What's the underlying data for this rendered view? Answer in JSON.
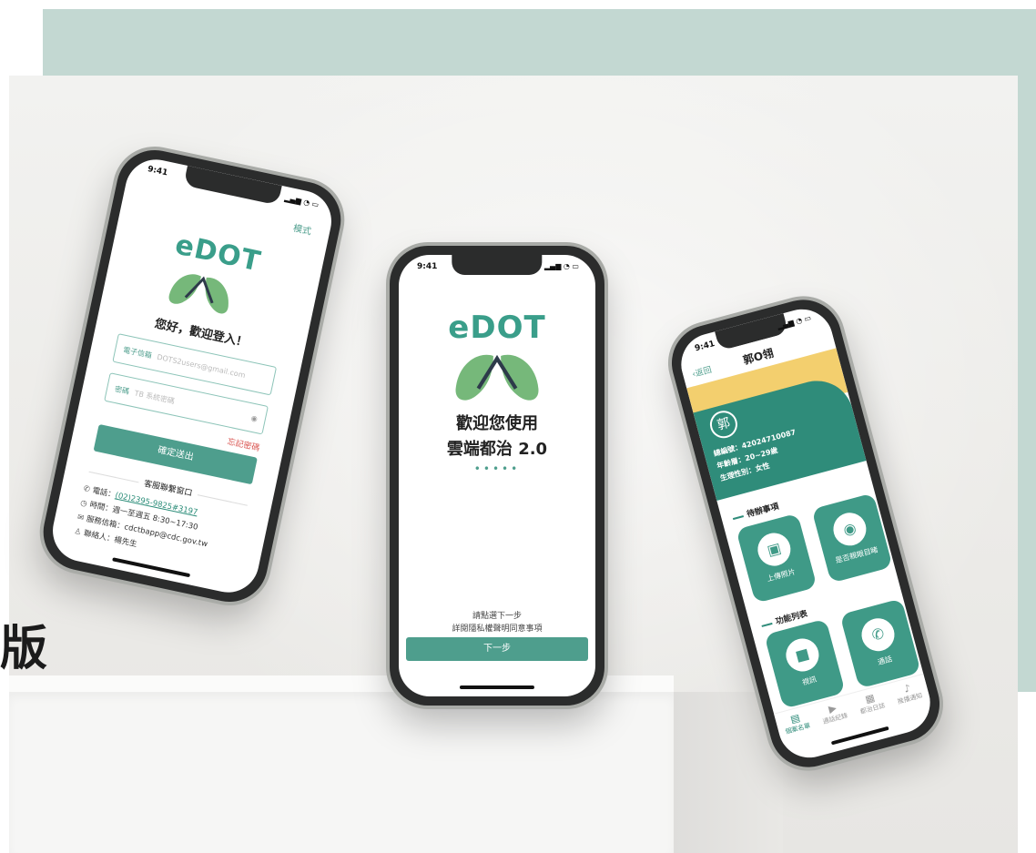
{
  "colors": {
    "accent": "#4e9e8d",
    "band": "#c3d8d2",
    "link": "#2a8c78",
    "warning": "#d9534f",
    "yellow": "#f3cf6e"
  },
  "hero_char": "版",
  "phone_login": {
    "time": "9:41",
    "mode_label": "模式",
    "brand": "eDOT",
    "greeting": "您好，歡迎登入！",
    "email_label": "電子信箱",
    "email_placeholder": "DOTS2users@gmail.com",
    "password_label": "密碼",
    "password_placeholder": "TB 系統密碼",
    "forgot_label": "忘記密碼",
    "submit_label": "確定送出",
    "service_title": "客服聯繫窗口",
    "phone_label": "電話：",
    "phone_value": "(02)2395-9825#3197",
    "hours": "時間：週一至週五 8:30~17:30",
    "email_service": "服務信箱：cdctbapp@cdc.gov.tw",
    "contact": "聯絡人：楊先生"
  },
  "phone_welcome": {
    "time": "9:41",
    "brand": "eDOT",
    "welcome_line1": "歡迎您使用",
    "welcome_line2": "雲端都治 2.0",
    "dots": "•••••",
    "hint_line1": "請點選下一步",
    "hint_line2": "詳閱隱私權聲明同意事項",
    "next_label": "下一步"
  },
  "phone_profile": {
    "time": "9:41",
    "back_label": "返回",
    "title": "郭O翎",
    "avatar_char": "郭",
    "case_no": "總編號：42024710087",
    "age": "年齡層：20~29歲",
    "gender": "生理性別：女性",
    "section_todo": "待辦事項",
    "tile_upload": "上傳照片",
    "tile_observe": "是否親眼目睹",
    "section_features": "功能列表",
    "tile_video": "視訊",
    "tile_call": "通話",
    "tabs": [
      "個案名單",
      "通話紀錄",
      "都治日誌",
      "推播通知"
    ]
  }
}
